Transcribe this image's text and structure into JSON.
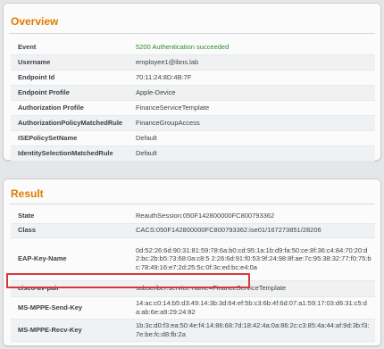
{
  "overview": {
    "title": "Overview",
    "rows": [
      {
        "key": "Event",
        "value": "5200 Authentication succeeded"
      },
      {
        "key": "Username",
        "value": "employee1@ibns.lab"
      },
      {
        "key": "Endpoint Id",
        "value": "70:11:24:8D:4B:7F"
      },
      {
        "key": "Endpoint Profile",
        "value": "Apple-Device"
      },
      {
        "key": "Authorization Profile",
        "value": "FinanceServiceTemplate"
      },
      {
        "key": "AuthorizationPolicyMatchedRule",
        "value": "FinanceGroupAccess"
      },
      {
        "key": "ISEPolicySetName",
        "value": "Default"
      },
      {
        "key": "IdentitySelectionMatchedRule",
        "value": "Default"
      }
    ]
  },
  "result": {
    "title": "Result",
    "rows": [
      {
        "key": "State",
        "value": "ReauthSession:050F142800000FC800793362"
      },
      {
        "key": "Class",
        "value": "CACS:050F142800000FC800793362:ise01/167273851/28206"
      },
      {
        "key": "EAP-Key-Name",
        "value": "0d:52:26:6d:90:31:81:59:78:6a:b0:cd:95:1a:1b:d9:fa:50:ce:8f:36:c4:84:70:20:d2:bc:2b:b5:73:68:0a:c8:5 2:26:6d:91:f0:53:9f:24:98:8f:ae:7c:95:38:32:77:f0:75:bc:78:49:16:e7:2d:25:5c:0f:3c:ed:bc:e4:0a"
      },
      {
        "key": "cisco-av-pair",
        "value": "subscriber:service-name=FinanceServiceTemplate"
      },
      {
        "key": "MS-MPPE-Send-Key",
        "value": "14:ac:c0:14:b5:d3:49:14:3b:3d:64:ef:5b:c3:6b:4f:6d:07:a1:59:17:03:d6:31:c5:da:ab:6e:a9:29:24:82"
      },
      {
        "key": "MS-MPPE-Recv-Key",
        "value": "1b:3c:d0:f3:ea:50:4e:f4:14:86:68:7d:18:42:4a:0a:86:2c:c3:85:4a:44:af:9d:3b:f3:7e:be:fc:d8:fb:2a"
      }
    ]
  },
  "colors": {
    "title": "#e07b00",
    "success": "#2c8a2c",
    "highlight": "#d9373a"
  }
}
